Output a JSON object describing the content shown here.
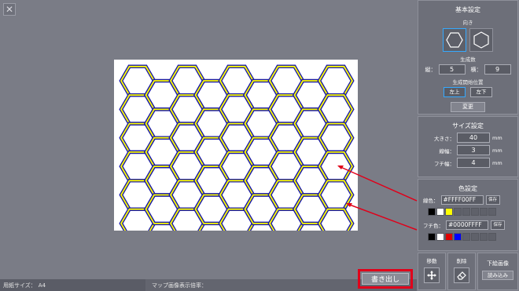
{
  "close_icon": "close-x-icon",
  "status": {
    "paper_label": "用紙サイズ：",
    "paper_value": "A4",
    "zoom_label": "マップ画像表示倍率："
  },
  "export_label": "書き出し",
  "basic": {
    "title": "基本設定",
    "orientation_label": "向き",
    "count_label": "生成数",
    "vertical_label": "縦：",
    "vertical_value": "5",
    "horizontal_label": "横：",
    "horizontal_value": "9",
    "start_label": "生成開始位置",
    "start_left_top": "左上",
    "start_left_bottom": "左下",
    "change_label": "変更"
  },
  "size": {
    "title": "サイズ設定",
    "rows": [
      {
        "label": "大きさ：",
        "value": "40",
        "unit": "mm"
      },
      {
        "label": "線幅：",
        "value": "3",
        "unit": "mm"
      },
      {
        "label": "フチ幅：",
        "value": "4",
        "unit": "mm"
      }
    ]
  },
  "color": {
    "title": "色設定",
    "line_label": "線色：",
    "line_value": "#FFFF00FF",
    "border_label": "フチ色：",
    "border_value": "#0000FFFF",
    "save_label": "保存",
    "line_swatches": [
      "#000000",
      "#ffffff",
      "#ffff00"
    ],
    "border_swatches": [
      "#000000",
      "#ffffff",
      "#e00000",
      "#0000ff"
    ],
    "line_color": "#ffff00",
    "border_color": "#1a1aa8"
  },
  "tools": {
    "move_label": "移動",
    "delete_label": "削除",
    "underlay_label": "下絵画像",
    "load_label": "読み込み"
  },
  "accent": "#e0001a"
}
